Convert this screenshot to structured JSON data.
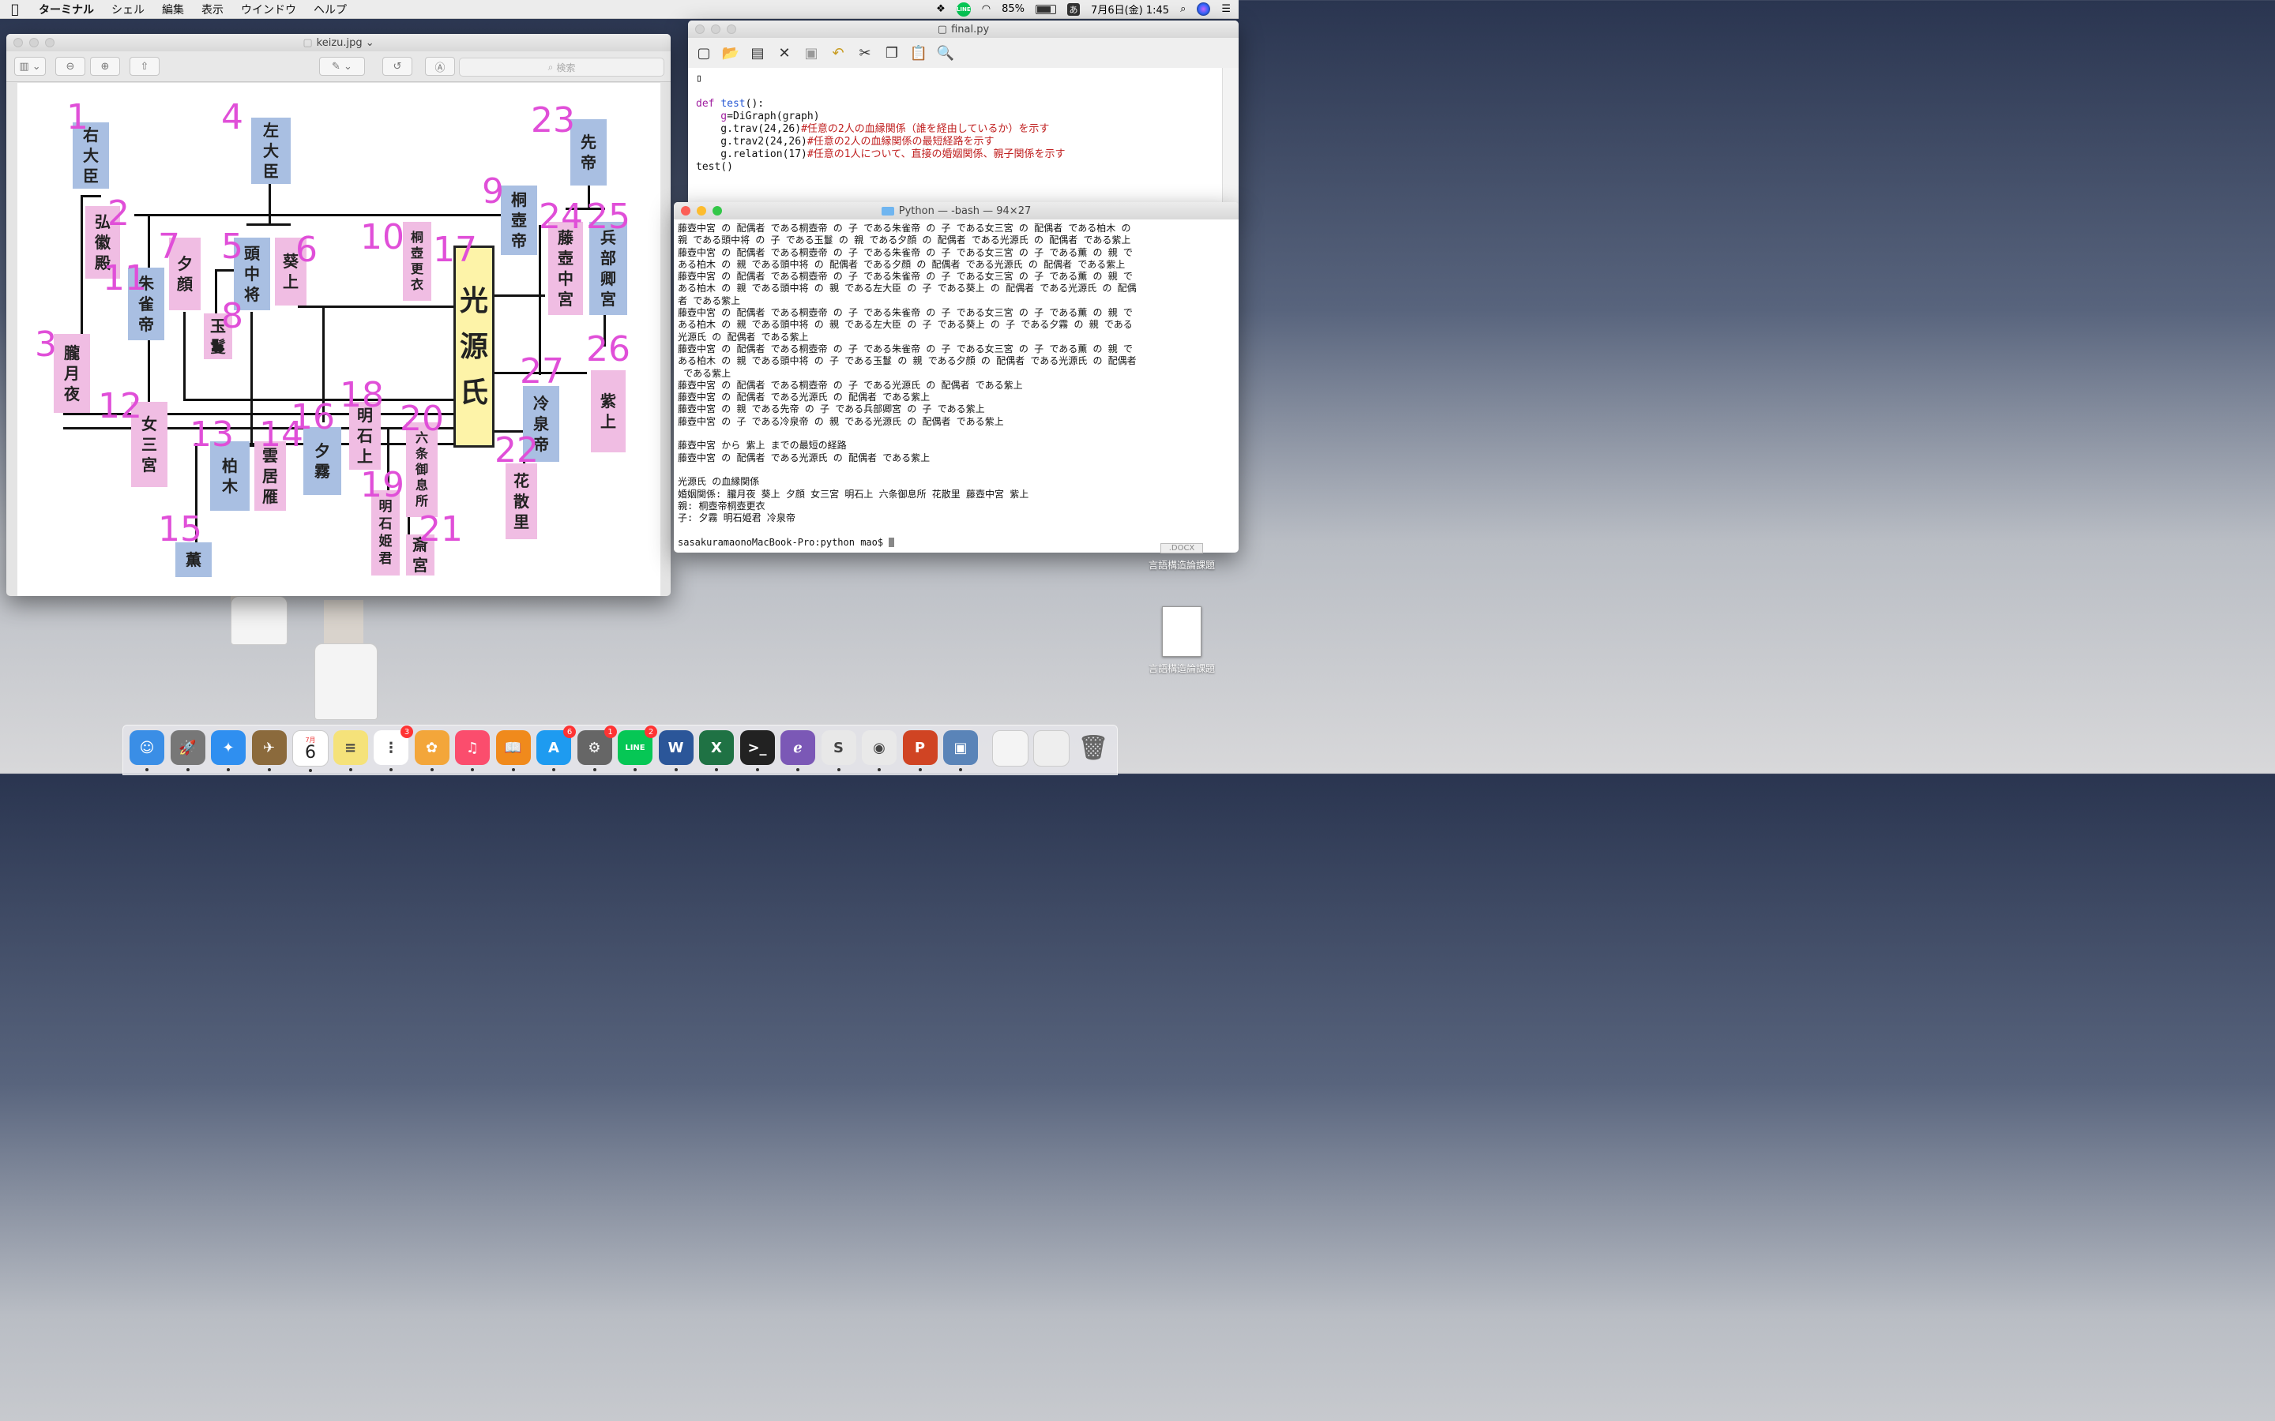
{
  "menubar": {
    "app": "ターミナル",
    "items": [
      "シェル",
      "編集",
      "表示",
      "ウインドウ",
      "ヘルプ"
    ],
    "battery": "85%",
    "battery_level": 0.85,
    "ime": "あ",
    "datetime": "7月6日(金) 1:45",
    "line_label": "LINE"
  },
  "preview": {
    "title": "keizu.jpg ⌄",
    "search_placeholder": "検索",
    "toolbar_icons": [
      "sidebar-icon",
      "zoom-out-icon",
      "zoom-in-icon",
      "share-icon",
      "markup-pen-icon",
      "rotate-icon",
      "annotate-icon"
    ],
    "diagram": {
      "nodes": [
        {
          "id": "1",
          "text": "右大臣",
          "color": "blue"
        },
        {
          "id": "2",
          "text": "弘徽殿",
          "color": "pink"
        },
        {
          "id": "3",
          "text": "朧月夜",
          "color": "pink"
        },
        {
          "id": "4",
          "text": "左大臣",
          "color": "blue"
        },
        {
          "id": "5",
          "text": "頭中将",
          "color": "blue"
        },
        {
          "id": "6",
          "text": "葵上",
          "color": "pink"
        },
        {
          "id": "7",
          "text": "夕顔",
          "color": "pink"
        },
        {
          "id": "8",
          "text": "玉鬘",
          "color": "pink"
        },
        {
          "id": "9",
          "text": "桐壺帝",
          "color": "blue"
        },
        {
          "id": "10",
          "text": "桐壺更衣",
          "color": "pink"
        },
        {
          "id": "11",
          "text": "朱雀帝",
          "color": "blue"
        },
        {
          "id": "12",
          "text": "女三宮",
          "color": "pink"
        },
        {
          "id": "13",
          "text": "柏木",
          "color": "blue"
        },
        {
          "id": "14",
          "text": "雲居雁",
          "color": "pink"
        },
        {
          "id": "15",
          "text": "薫",
          "color": "blue"
        },
        {
          "id": "16",
          "text": "夕霧",
          "color": "blue"
        },
        {
          "id": "17",
          "text": "光源氏",
          "color": "gold"
        },
        {
          "id": "18",
          "text": "明石上",
          "color": "pink"
        },
        {
          "id": "19",
          "text": "明石姫君",
          "color": "pink"
        },
        {
          "id": "20",
          "text": "六条御息所",
          "color": "pink"
        },
        {
          "id": "21",
          "text": "斎宮",
          "color": "pink"
        },
        {
          "id": "22",
          "text": "花散里",
          "color": "pink"
        },
        {
          "id": "23",
          "text": "先帝",
          "color": "blue"
        },
        {
          "id": "24",
          "text": "藤壺中宮",
          "color": "pink"
        },
        {
          "id": "25",
          "text": "兵部卿宮",
          "color": "blue"
        },
        {
          "id": "26",
          "text": "紫上",
          "color": "pink"
        },
        {
          "id": "27",
          "text": "冷泉帝",
          "color": "blue"
        }
      ]
    }
  },
  "editor": {
    "title": "final.py",
    "toolbar_icons": [
      "new-file-icon",
      "open-folder-icon",
      "save-all-icon",
      "close-icon",
      "save-icon",
      "undo-icon",
      "cut-icon",
      "copy-icon",
      "paste-icon",
      "find-icon"
    ],
    "lines": [
      [
        {
          "t": "",
          "c": "pl"
        }
      ],
      [
        {
          "t": "",
          "c": "pl"
        }
      ],
      [
        {
          "t": "def ",
          "c": "kw"
        },
        {
          "t": "test",
          "c": "fn"
        },
        {
          "t": "():",
          "c": "pl"
        }
      ],
      [
        {
          "t": "    g",
          "c": "kw"
        },
        {
          "t": "=DiGraph(graph)",
          "c": "pl"
        }
      ],
      [
        {
          "t": "    g.trav(24,26)",
          "c": "pl"
        },
        {
          "t": "#任意の2人の血縁関係（誰を経由しているか）を示す",
          "c": "cm"
        }
      ],
      [
        {
          "t": "    g.trav2(24,26)",
          "c": "pl"
        },
        {
          "t": "#任意の2人の血縁関係の最短経路を示す",
          "c": "cm"
        }
      ],
      [
        {
          "t": "    g.relation(17)",
          "c": "pl"
        },
        {
          "t": "#任意の1人について、直接の婚姻関係、親子関係を示す",
          "c": "cm"
        }
      ],
      [
        {
          "t": "test()",
          "c": "pl"
        }
      ]
    ]
  },
  "terminal": {
    "title": "Python — -bash — 94×27",
    "lines": [
      "藤壺中宮 の 配偶者 である桐壺帝 の 子 である朱雀帝 の 子 である女三宮 の 配偶者 である柏木 の",
      "親 である頭中将 の 子 である玉鬘 の 親 である夕顔 の 配偶者 である光源氏 の 配偶者 である紫上",
      "藤壺中宮 の 配偶者 である桐壺帝 の 子 である朱雀帝 の 子 である女三宮 の 子 である薫 の 親 で",
      "ある柏木 の 親 である頭中将 の 配偶者 である夕顔 の 配偶者 である光源氏 の 配偶者 である紫上",
      "藤壺中宮 の 配偶者 である桐壺帝 の 子 である朱雀帝 の 子 である女三宮 の 子 である薫 の 親 で",
      "ある柏木 の 親 である頭中将 の 親 である左大臣 の 子 である葵上 の 配偶者 である光源氏 の 配偶",
      "者 である紫上",
      "藤壺中宮 の 配偶者 である桐壺帝 の 子 である朱雀帝 の 子 である女三宮 の 子 である薫 の 親 で",
      "ある柏木 の 親 である頭中将 の 親 である左大臣 の 子 である葵上 の 子 である夕霧 の 親 である",
      "光源氏 の 配偶者 である紫上",
      "藤壺中宮 の 配偶者 である桐壺帝 の 子 である朱雀帝 の 子 である女三宮 の 子 である薫 の 親 で",
      "ある柏木 の 親 である頭中将 の 子 である玉鬘 の 親 である夕顔 の 配偶者 である光源氏 の 配偶者",
      " である紫上",
      "藤壺中宮 の 配偶者 である桐壺帝 の 子 である光源氏 の 配偶者 である紫上",
      "藤壺中宮 の 配偶者 である光源氏 の 配偶者 である紫上",
      "藤壺中宮 の 親 である先帝 の 子 である兵部卿宮 の 子 である紫上",
      "藤壺中宮 の 子 である冷泉帝 の 親 である光源氏 の 配偶者 である紫上",
      "",
      "藤壺中宮 から 紫上 までの最短の経路",
      "藤壺中宮 の 配偶者 である光源氏 の 配偶者 である紫上",
      "",
      "光源氏 の血縁関係",
      "婚姻関係: 朧月夜 葵上 夕顔 女三宮 明石上 六条御息所 花散里 藤壺中宮 紫上",
      "親: 桐壺帝桐壺更衣",
      "子: 夕霧 明石姫君 冷泉帝",
      "",
      "sasakuramaonoMacBook-Pro:python mao$ "
    ]
  },
  "desktop": {
    "files": [
      {
        "label": "言語構造論課題",
        "sub": ".DOCX"
      },
      {
        "label": "言語構造論課題",
        "sub": ""
      }
    ]
  },
  "dock": {
    "calendar_month": "7月",
    "calendar_day": "6",
    "apps": [
      {
        "name": "finder-icon",
        "color": "#3a8ee6",
        "glyph": "☺"
      },
      {
        "name": "launchpad-icon",
        "color": "#777",
        "glyph": "🚀"
      },
      {
        "name": "safari-icon",
        "color": "#2f8ff0",
        "glyph": "✦"
      },
      {
        "name": "preview-hawk-icon",
        "color": "#8b6a3c",
        "glyph": "✈"
      },
      {
        "name": "calendar-icon",
        "color": "#ffffff",
        "glyph": ""
      },
      {
        "name": "notes-icon",
        "color": "#f5e27a",
        "glyph": "≡"
      },
      {
        "name": "reminders-icon",
        "color": "#ffffff",
        "glyph": "⋮",
        "badge": "3"
      },
      {
        "name": "photos-icon",
        "color": "#f3a63a",
        "glyph": "✿"
      },
      {
        "name": "itunes-icon",
        "color": "#fb4d6d",
        "glyph": "♫"
      },
      {
        "name": "ibooks-icon",
        "color": "#f08a1c",
        "glyph": "📖"
      },
      {
        "name": "app-store-icon",
        "color": "#1e9bf0",
        "glyph": "A",
        "badge": "6"
      },
      {
        "name": "system-preferences-icon",
        "color": "#666",
        "glyph": "⚙",
        "badge": "1"
      },
      {
        "name": "line-icon",
        "color": "#06c755",
        "glyph": "LINE",
        "badge": "2"
      },
      {
        "name": "word-icon",
        "color": "#2b5699",
        "glyph": "W"
      },
      {
        "name": "excel-icon",
        "color": "#1f7244",
        "glyph": "X"
      },
      {
        "name": "terminal-icon",
        "color": "#222",
        "glyph": ">_"
      },
      {
        "name": "emacs-icon",
        "color": "#7b58b6",
        "glyph": "ℯ"
      },
      {
        "name": "slack-icon",
        "color": "#e8e8e8",
        "glyph": "S"
      },
      {
        "name": "chrome-icon",
        "color": "#e9e9e9",
        "glyph": "◉"
      },
      {
        "name": "powerpoint-icon",
        "color": "#d04423",
        "glyph": "P"
      },
      {
        "name": "preview-icon",
        "color": "#5a84b8",
        "glyph": "▣"
      }
    ]
  }
}
